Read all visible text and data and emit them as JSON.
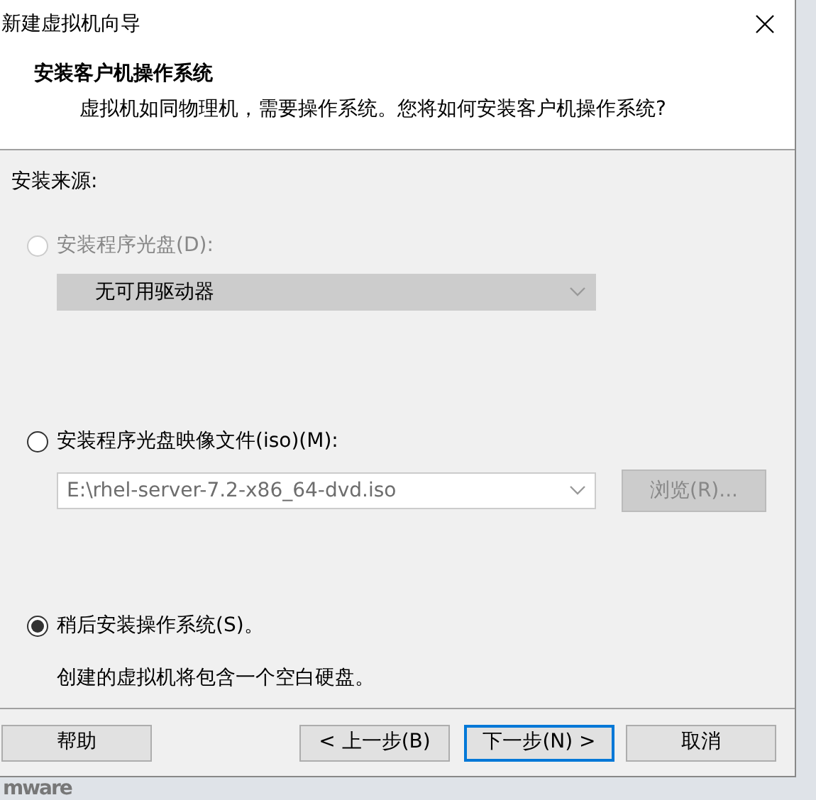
{
  "window": {
    "title": "新建虚拟机向导"
  },
  "header": {
    "title": "安装客户机操作系统",
    "subtitle": "虚拟机如同物理机，需要操作系统。您将如何安装客户机操作系统?"
  },
  "section_label": "安装来源:",
  "options": [
    {
      "label": "安装程序光盘(D):",
      "selected": false,
      "disabled": true,
      "select": {
        "value": "无可用驱动器",
        "disabled": true
      }
    },
    {
      "label": "安装程序光盘映像文件(iso)(M):",
      "selected": false,
      "disabled": false,
      "select": {
        "value": "E:\\rhel-server-7.2-x86_64-dvd.iso",
        "disabled": true
      },
      "browse": {
        "label": "浏览(R)...",
        "disabled": true
      }
    },
    {
      "label": "稍后安装操作系统(S)。",
      "selected": true,
      "disabled": false,
      "note": "创建的虚拟机将包含一个空白硬盘。"
    }
  ],
  "buttons": [
    {
      "label": "帮助",
      "default": false
    },
    {
      "label": "< 上一步(B)",
      "default": false
    },
    {
      "label": "下一步(N) >",
      "default": true
    },
    {
      "label": "取消",
      "default": false
    }
  ],
  "logo": "mware"
}
